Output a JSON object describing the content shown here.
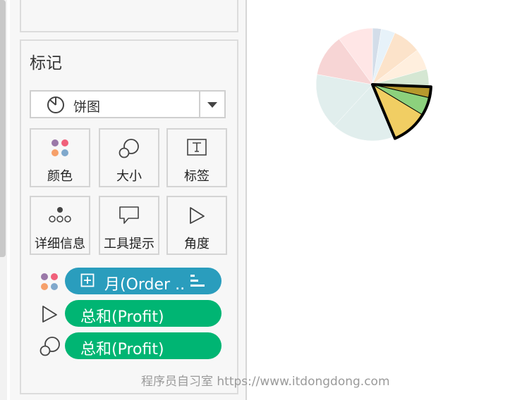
{
  "marks_card": {
    "title": "标记",
    "mark_type": {
      "label": "饼图",
      "icon": "pie-chart-icon"
    },
    "buttons": [
      {
        "label": "颜色",
        "icon": "color-dots-icon"
      },
      {
        "label": "大小",
        "icon": "size-circles-icon"
      },
      {
        "label": "标签",
        "icon": "label-t-icon"
      },
      {
        "label": "详细信息",
        "icon": "detail-dots-icon"
      },
      {
        "label": "工具提示",
        "icon": "tooltip-bubble-icon"
      },
      {
        "label": "角度",
        "icon": "angle-icon"
      }
    ],
    "fields": [
      {
        "role": "color",
        "label": "月(Order ..",
        "color": "#2a9dbd",
        "icon": "color-dots-icon"
      },
      {
        "role": "angle",
        "label": "总和(Profit)",
        "color": "#00b573",
        "icon": "angle-icon"
      },
      {
        "role": "size",
        "label": "总和(Profit)",
        "color": "#00b573",
        "icon": "size-circles-icon"
      }
    ]
  },
  "watermark": "程序员自习室 https://www.itdongdong.com",
  "chart_data": {
    "type": "pie",
    "values": [
      2.5,
      4,
      8,
      6,
      5,
      3,
      5,
      10,
      18,
      16,
      12,
      10
    ],
    "colors": [
      "#4e79a7",
      "#a0cbe8",
      "#f28e2b",
      "#ffbe7d",
      "#59a14f",
      "#b6992d",
      "#8cd17d",
      "#f1ce63",
      "#86bcb6",
      "#86bcb6",
      "#e15759",
      "#ff9d9a"
    ],
    "highlighted": [
      5,
      6,
      7
    ]
  }
}
